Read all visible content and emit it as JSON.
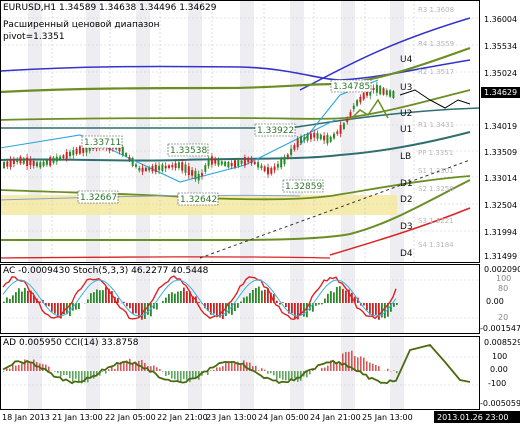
{
  "header": {
    "symbol_line": "EURUSD,H1  1.34589 1.34638 1.34496 1.34629",
    "indicator_title": "Расширенный ценовой диапазон",
    "pivot": "pivot=1.3351"
  },
  "price_axis": {
    "labels": [
      "1.36004",
      "1.35534",
      "1.35024",
      "1.34629",
      "1.34019",
      "1.33509",
      "1.33014",
      "1.32504",
      "1.31994",
      "1.31499"
    ],
    "current": "1.34629"
  },
  "levels": {
    "U4": "U4",
    "U3": "U3",
    "U2": "U2",
    "U1": "U1",
    "LB": "LB",
    "D1": "D1",
    "D2": "D2",
    "D3": "D3",
    "D4": "D4",
    "R3": "R3 1.3608",
    "R4": "R4 1.3559",
    "R2": "R2 1.3517",
    "R1": "R1 1.3431",
    "PP": "PP 1.3351",
    "S1": "S1 1.3301",
    "S2": "S2 1.3258",
    "S3": "S3 1.3221",
    "S4": "S4 1.3184"
  },
  "callouts": [
    "1.33711",
    "1.33538",
    "1.33922",
    "1.34785",
    "1.32859",
    "1.32667",
    "1.32642"
  ],
  "ac_pane": {
    "label": "AC -0.0009430  Stoch(5,3,3) 46.2277 40.5448",
    "axis": [
      "0.002090",
      "0.00",
      "100",
      "80",
      "0.00",
      "20",
      "-0.001547",
      "0"
    ]
  },
  "ad_pane": {
    "label": "AD 0.005950  CCI(14) 33.8758",
    "axis": [
      "0.008529",
      "100",
      "0.00",
      "-100",
      "-0.005059"
    ]
  },
  "time_axis": {
    "labels": [
      "18 Jan 2013",
      "21 Jan 13:00",
      "22 Jan 05:00",
      "22 Jan 21:00",
      "23 Jan 13:00",
      "24 Jan 05:00",
      "24 Jan 21:00",
      "25 Jan 13:00"
    ],
    "current": "2013.01.26 23:00"
  },
  "colors": {
    "candle_up": "#2a8a2a",
    "candle_down": "#cc2222",
    "band_olive": "#6b8e23",
    "band_blue": "#3333cc",
    "band_teal": "#2f6f6f",
    "band_red": "#dd2222",
    "highlight": "#f5e9a0",
    "current_price_bg": "#000000"
  }
}
